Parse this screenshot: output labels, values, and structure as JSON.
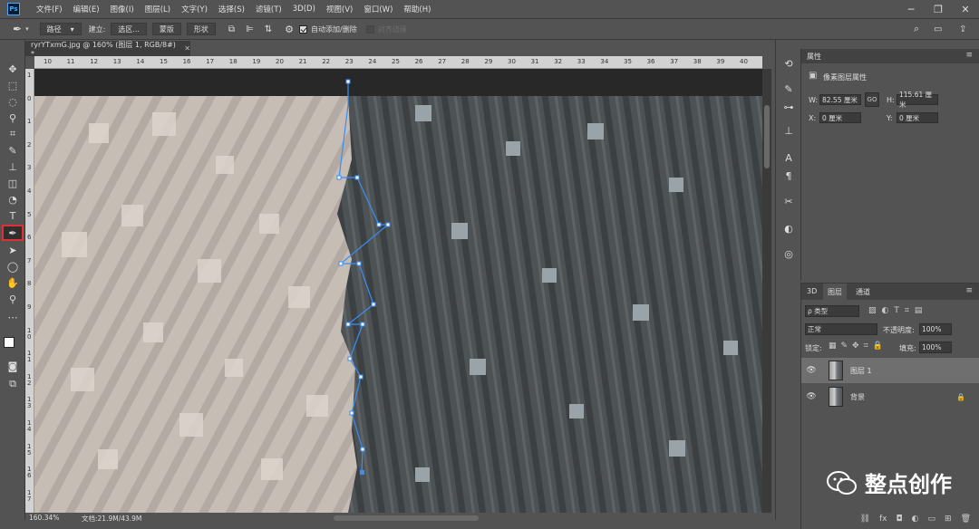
{
  "menubar": {
    "logo": "Ps",
    "items": [
      "文件(F)",
      "编辑(E)",
      "图像(I)",
      "图层(L)",
      "文字(Y)",
      "选择(S)",
      "滤镜(T)",
      "3D(D)",
      "视图(V)",
      "窗口(W)",
      "帮助(H)"
    ]
  },
  "options": {
    "mode": "路径",
    "make_label": "建立:",
    "selection_btn": "选区...",
    "mask_btn": "蒙版",
    "shape_btn": "形状",
    "auto_add": "自动添加/删除",
    "align_edges": "对齐边缘"
  },
  "document": {
    "tab_title": "ryrYTxmG.jpg @ 160% (图层 1, RGB/8#) *",
    "zoom": "160.34%",
    "doc_size": "文档:21.9M/43.9M"
  },
  "ruler": {
    "top": [
      "10",
      "11",
      "12",
      "13",
      "14",
      "15",
      "16",
      "17",
      "18",
      "19",
      "20",
      "21",
      "22",
      "23",
      "24",
      "25",
      "26",
      "27",
      "28",
      "29",
      "30",
      "31",
      "32",
      "33",
      "34",
      "35",
      "36",
      "37",
      "38",
      "39",
      "40"
    ],
    "left": [
      "1",
      "0",
      "1",
      "2",
      "3",
      "4",
      "5",
      "6",
      "7",
      "8",
      "9",
      "1 0",
      "1 1",
      "1 2",
      "1 3",
      "1 4",
      "1 5",
      "1 6",
      "1 7"
    ]
  },
  "properties": {
    "tab": "属性",
    "section": "像素图层属性",
    "w_label": "W:",
    "w_value": "82.55 厘米",
    "link_label": "GO",
    "h_label": "H:",
    "h_value": "115.61 厘米",
    "x_label": "X:",
    "x_value": "0 厘米",
    "y_label": "Y:",
    "y_value": "0 厘米"
  },
  "layers": {
    "tabs": [
      "3D",
      "图层",
      "通道"
    ],
    "filter": "ρ 类型",
    "blend": "正常",
    "opacity_label": "不透明度:",
    "opacity": "100%",
    "lock_label": "锁定:",
    "fill_label": "填充:",
    "fill": "100%",
    "items": [
      {
        "name": "图层 1",
        "selected": true
      },
      {
        "name": "背景",
        "selected": false
      }
    ]
  },
  "watermark": "整点创作",
  "colors": {
    "accent": "#e03030",
    "path": "#3a8ef5"
  }
}
